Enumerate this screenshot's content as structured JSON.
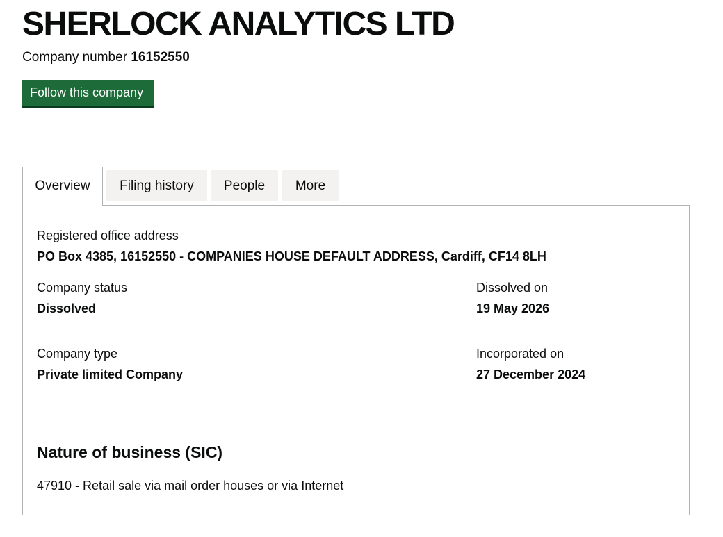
{
  "company": {
    "name": "SHERLOCK ANALYTICS LTD",
    "number_label": "Company number",
    "number": "16152550",
    "follow_label": "Follow this company"
  },
  "tabs": [
    {
      "label": "Overview",
      "selected": true
    },
    {
      "label": "Filing history",
      "selected": false
    },
    {
      "label": "People",
      "selected": false
    },
    {
      "label": "More",
      "selected": false
    }
  ],
  "overview": {
    "registered_office": {
      "label": "Registered office address",
      "value": "PO Box 4385, 16152550 - COMPANIES HOUSE DEFAULT ADDRESS, Cardiff, CF14 8LH"
    },
    "status": {
      "label": "Company status",
      "value": "Dissolved"
    },
    "dissolved_on": {
      "label": "Dissolved on",
      "value": "19 May 2026"
    },
    "type": {
      "label": "Company type",
      "value": "Private limited Company"
    },
    "incorporated_on": {
      "label": "Incorporated on",
      "value": "27 December 2024"
    },
    "nature_heading": "Nature of business (SIC)",
    "sic": [
      "47910 - Retail sale via mail order houses or via Internet"
    ]
  },
  "colors": {
    "button_bg": "#1d6b39",
    "tab_bg": "#f3f2f1",
    "border": "#b1b4b6",
    "text": "#0b0c0c"
  }
}
